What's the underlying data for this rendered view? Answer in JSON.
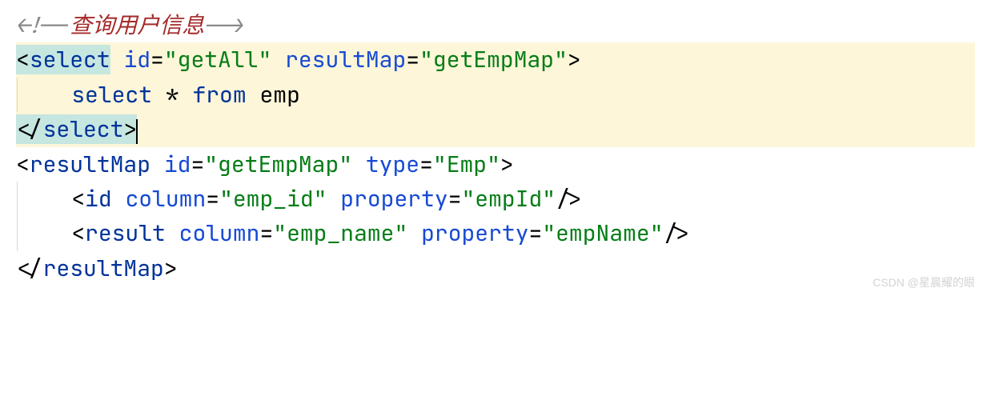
{
  "code": {
    "line1": {
      "open": "<!--",
      "text": "查询用户信息",
      "close": "-->"
    },
    "line2": {
      "lt": "<",
      "tag": "select",
      "sp1": " ",
      "attr1": "id",
      "eq1": "=",
      "val1": "\"getAll\"",
      "sp2": " ",
      "attr2": "resultMap",
      "eq2": "=",
      "val2": "\"getEmpMap\"",
      "gt": ">"
    },
    "line3": {
      "indent": "    ",
      "kw1": "select",
      "sp1": " ",
      "star": "*",
      "sp2": " ",
      "kw2": "from",
      "sp3": " ",
      "tbl": "emp"
    },
    "line4": {
      "lt": "</",
      "tag": "select",
      "gt": ">"
    },
    "line5": {
      "lt": "<",
      "tag": "resultMap",
      "sp1": " ",
      "attr1": "id",
      "eq1": "=",
      "val1": "\"getEmpMap\"",
      "sp2": " ",
      "attr2": "type",
      "eq2": "=",
      "val2": "\"Emp\"",
      "gt": ">"
    },
    "line6": {
      "indent": "    ",
      "lt": "<",
      "tag": "id",
      "sp1": " ",
      "attr1": "column",
      "eq1": "=",
      "val1": "\"emp_id\"",
      "sp2": " ",
      "attr2": "property",
      "eq2": "=",
      "val2": "\"empId\"",
      "gt": "/>"
    },
    "line7": {
      "indent": "    ",
      "lt": "<",
      "tag": "result",
      "sp1": " ",
      "attr1": "column",
      "eq1": "=",
      "val1": "\"emp_name\"",
      "sp2": " ",
      "attr2": "property",
      "eq2": "=",
      "val2": "\"empName\"",
      "gt": "/>"
    },
    "line8": {
      "lt": "</",
      "tag": "resultMap",
      "gt": ">"
    }
  },
  "watermark": "CSDN @星晨耀的眼"
}
